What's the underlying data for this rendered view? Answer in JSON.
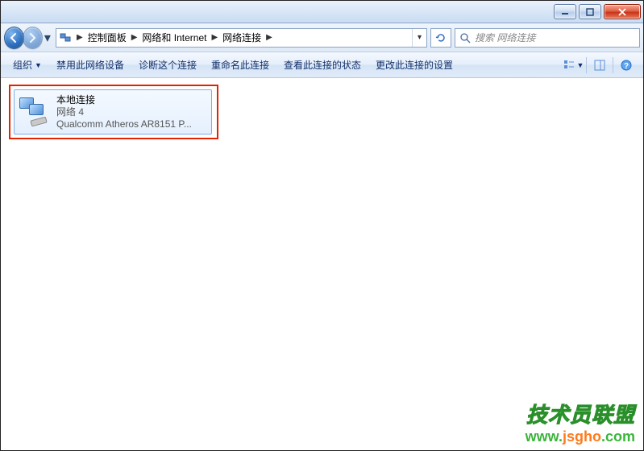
{
  "breadcrumb": {
    "b0": "控制面板",
    "b1": "网络和 Internet",
    "b2": "网络连接"
  },
  "search": {
    "placeholder": "搜索 网络连接"
  },
  "toolbar": {
    "t0": "组织",
    "t1": "禁用此网络设备",
    "t2": "诊断这个连接",
    "t3": "重命名此连接",
    "t4": "查看此连接的状态",
    "t5": "更改此连接的设置"
  },
  "connection": {
    "name": "本地连接",
    "network": "网络  4",
    "device": "Qualcomm Atheros AR8151 P..."
  },
  "watermark": {
    "title": "技术员联盟",
    "url": "www.jsgho.com"
  }
}
